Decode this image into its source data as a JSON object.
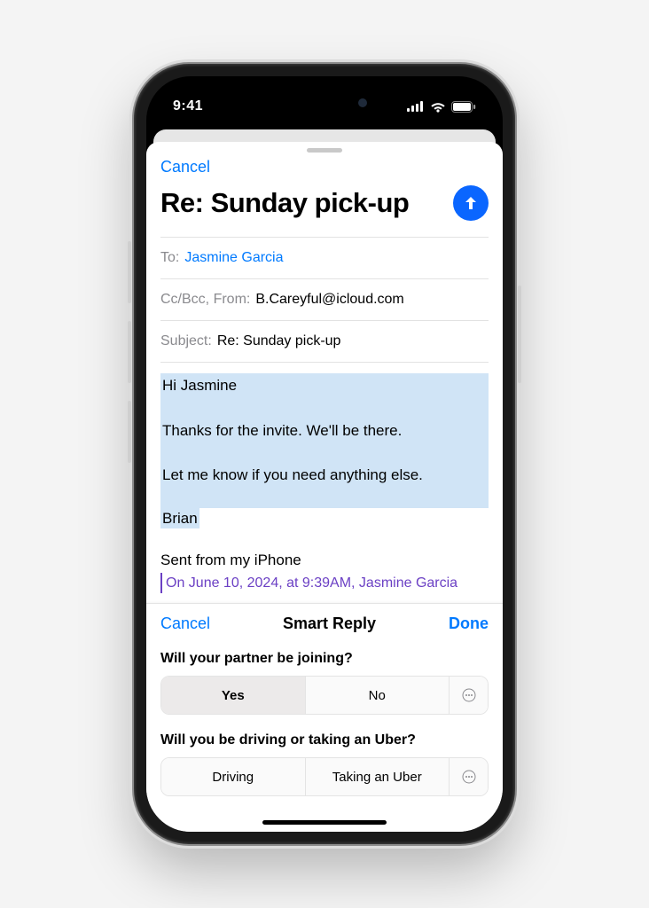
{
  "status": {
    "time": "9:41"
  },
  "compose": {
    "cancel": "Cancel",
    "title": "Re: Sunday pick-up",
    "to_label": "To:",
    "to_value": "Jasmine Garcia",
    "ccbcc_label": "Cc/Bcc, From:",
    "from_value": "B.Careyful@icloud.com",
    "subject_label": "Subject:",
    "subject_value": "Re: Sunday pick-up",
    "body": {
      "line1": "Hi Jasmine",
      "line2": "Thanks for the invite. We'll be there.",
      "line3": "Let me know if you need anything else.",
      "line4": "Brian"
    },
    "signature": "Sent from my iPhone",
    "quote_meta": "On June 10, 2024, at 9:39AM, Jasmine Garcia"
  },
  "panel": {
    "cancel": "Cancel",
    "title": "Smart Reply",
    "done": "Done",
    "q1": {
      "text": "Will your partner be joining?",
      "opt1": "Yes",
      "opt2": "No"
    },
    "q2": {
      "text": "Will you be driving or taking an Uber?",
      "opt1": "Driving",
      "opt2": "Taking an Uber"
    }
  }
}
